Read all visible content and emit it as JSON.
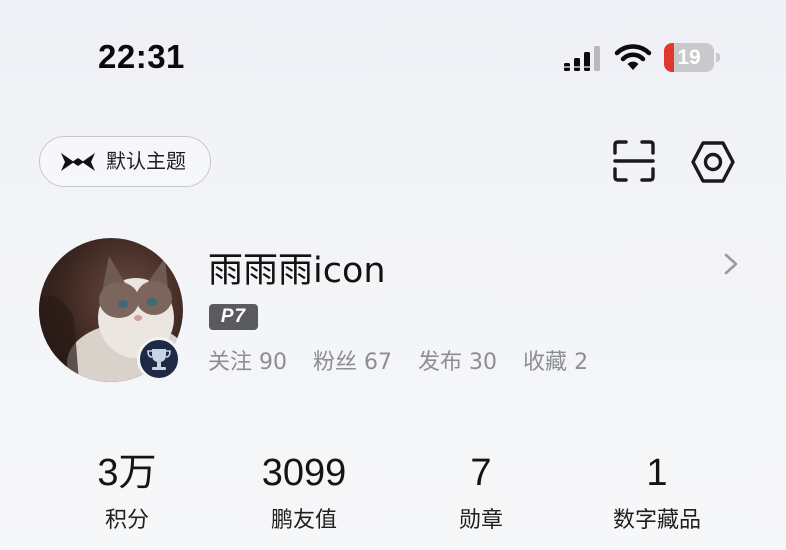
{
  "status_bar": {
    "time": "22:31",
    "signal_icon": "cellular-signal-icon",
    "wifi_icon": "wifi-icon",
    "battery_level": "19",
    "battery_fraction": 0.19,
    "battery_color": "#e0382e"
  },
  "header": {
    "theme_label": "默认主题",
    "theme_icon": "xpeng-logo-icon",
    "scan_icon": "scan-icon",
    "settings_icon": "hex-nut-settings-icon"
  },
  "profile": {
    "username": "雨雨雨icon",
    "level": "P7",
    "chevron_icon": "chevron-right-icon",
    "social": [
      {
        "label": "关注",
        "count": "90"
      },
      {
        "label": "粉丝",
        "count": "67"
      },
      {
        "label": "发布",
        "count": "30"
      },
      {
        "label": "收藏",
        "count": "2"
      }
    ]
  },
  "metrics": [
    {
      "value": "3万",
      "label": "积分"
    },
    {
      "value": "3099",
      "label": "鹏友值"
    },
    {
      "value": "7",
      "label": "勋章"
    },
    {
      "value": "1",
      "label": "数字藏品"
    }
  ]
}
